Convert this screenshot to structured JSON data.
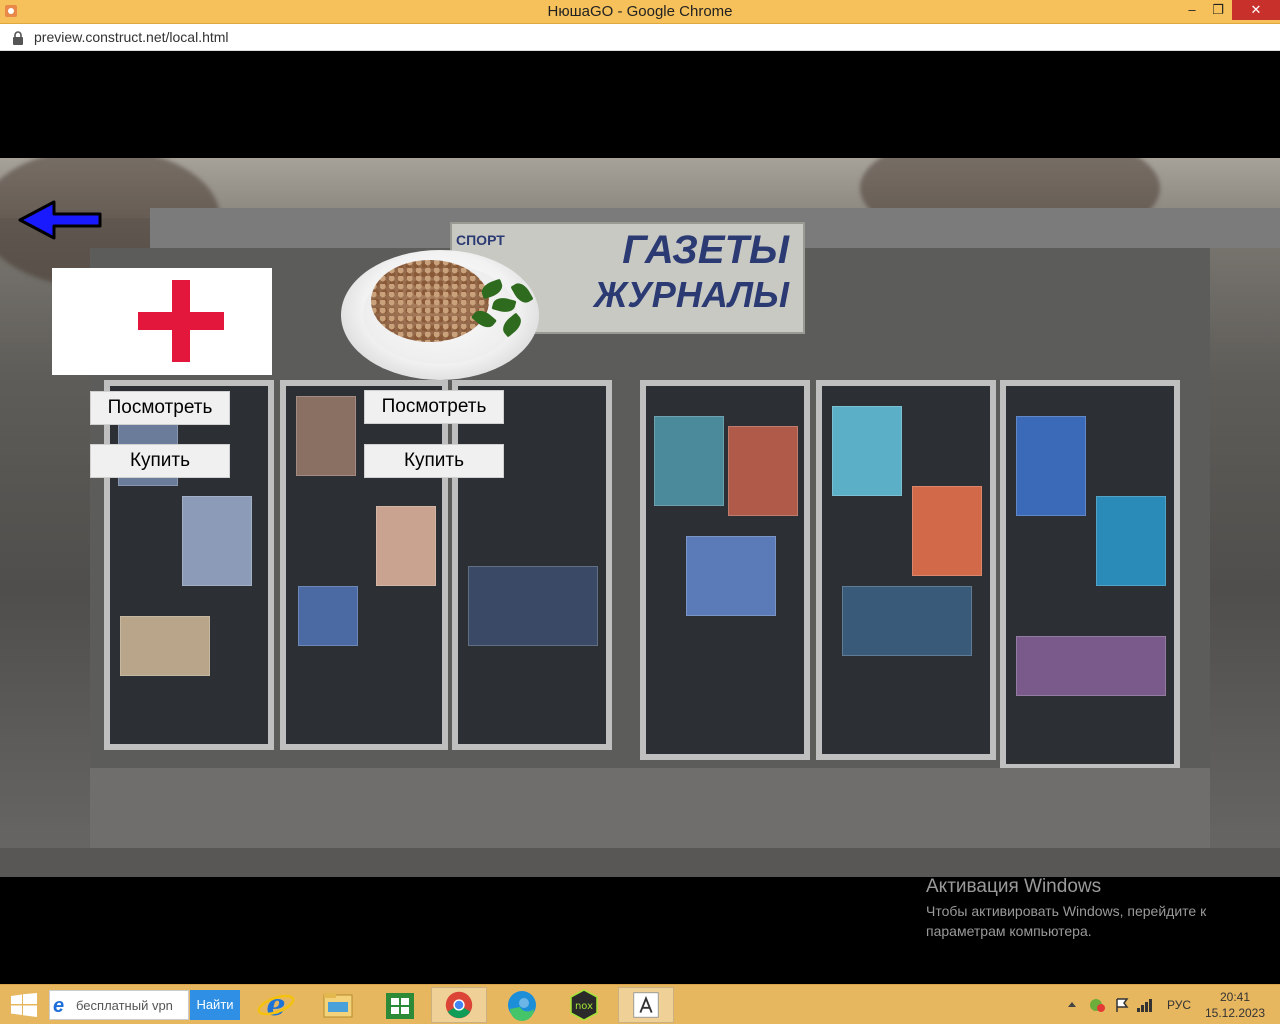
{
  "window": {
    "title": "НюшаGO - Google Chrome",
    "minimize": "–",
    "maximize": "❐",
    "close": "✕"
  },
  "address": {
    "url": "preview.construct.net/local.html"
  },
  "scene": {
    "sign_top": "ГАЗЕТЫ",
    "sign_bottom": "ЖУРНАЛЫ",
    "sign_small": "СПОРТ"
  },
  "items": [
    {
      "view_label": "Посмотреть",
      "buy_label": "Купить"
    },
    {
      "view_label": "Посмотреть",
      "buy_label": "Купить"
    }
  ],
  "activation": {
    "title": "Активация Windows",
    "text": "Чтобы активировать Windows, перейдите к параметрам компьютера."
  },
  "taskbar": {
    "search_value": "бесплатный vpn",
    "search_button": "Найти",
    "lang": "РУС",
    "time": "20:41",
    "date": "15.12.2023"
  },
  "colors": {
    "titlebar": "#f6c15a",
    "taskbar": "#e7b760",
    "cross": "#e3163c",
    "arrow": "#1a1aff"
  }
}
